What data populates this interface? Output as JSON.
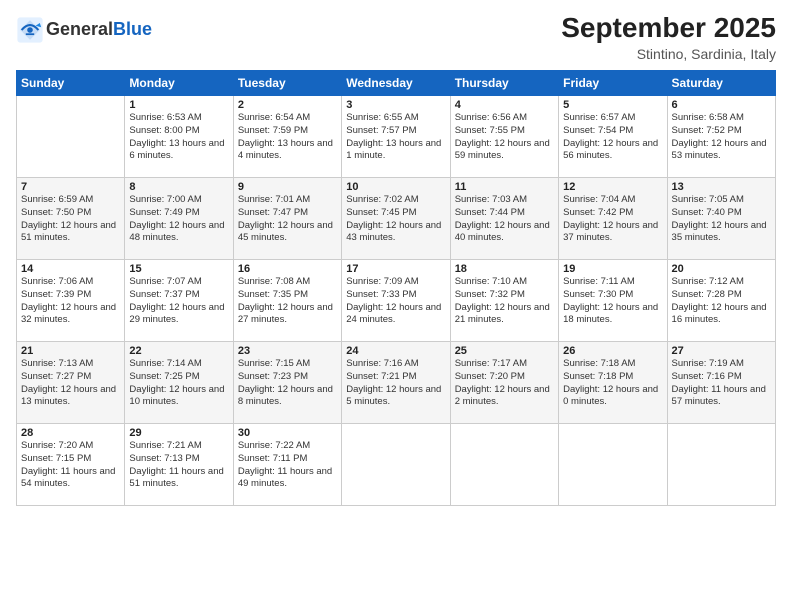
{
  "header": {
    "logo_text_general": "General",
    "logo_text_blue": "Blue",
    "title": "September 2025",
    "subtitle": "Stintino, Sardinia, Italy"
  },
  "days_of_week": [
    "Sunday",
    "Monday",
    "Tuesday",
    "Wednesday",
    "Thursday",
    "Friday",
    "Saturday"
  ],
  "weeks": [
    [
      {
        "date": "",
        "sunrise": "",
        "sunset": "",
        "daylight": ""
      },
      {
        "date": "1",
        "sunrise": "Sunrise: 6:53 AM",
        "sunset": "Sunset: 8:00 PM",
        "daylight": "Daylight: 13 hours and 6 minutes."
      },
      {
        "date": "2",
        "sunrise": "Sunrise: 6:54 AM",
        "sunset": "Sunset: 7:59 PM",
        "daylight": "Daylight: 13 hours and 4 minutes."
      },
      {
        "date": "3",
        "sunrise": "Sunrise: 6:55 AM",
        "sunset": "Sunset: 7:57 PM",
        "daylight": "Daylight: 13 hours and 1 minute."
      },
      {
        "date": "4",
        "sunrise": "Sunrise: 6:56 AM",
        "sunset": "Sunset: 7:55 PM",
        "daylight": "Daylight: 12 hours and 59 minutes."
      },
      {
        "date": "5",
        "sunrise": "Sunrise: 6:57 AM",
        "sunset": "Sunset: 7:54 PM",
        "daylight": "Daylight: 12 hours and 56 minutes."
      },
      {
        "date": "6",
        "sunrise": "Sunrise: 6:58 AM",
        "sunset": "Sunset: 7:52 PM",
        "daylight": "Daylight: 12 hours and 53 minutes."
      }
    ],
    [
      {
        "date": "7",
        "sunrise": "Sunrise: 6:59 AM",
        "sunset": "Sunset: 7:50 PM",
        "daylight": "Daylight: 12 hours and 51 minutes."
      },
      {
        "date": "8",
        "sunrise": "Sunrise: 7:00 AM",
        "sunset": "Sunset: 7:49 PM",
        "daylight": "Daylight: 12 hours and 48 minutes."
      },
      {
        "date": "9",
        "sunrise": "Sunrise: 7:01 AM",
        "sunset": "Sunset: 7:47 PM",
        "daylight": "Daylight: 12 hours and 45 minutes."
      },
      {
        "date": "10",
        "sunrise": "Sunrise: 7:02 AM",
        "sunset": "Sunset: 7:45 PM",
        "daylight": "Daylight: 12 hours and 43 minutes."
      },
      {
        "date": "11",
        "sunrise": "Sunrise: 7:03 AM",
        "sunset": "Sunset: 7:44 PM",
        "daylight": "Daylight: 12 hours and 40 minutes."
      },
      {
        "date": "12",
        "sunrise": "Sunrise: 7:04 AM",
        "sunset": "Sunset: 7:42 PM",
        "daylight": "Daylight: 12 hours and 37 minutes."
      },
      {
        "date": "13",
        "sunrise": "Sunrise: 7:05 AM",
        "sunset": "Sunset: 7:40 PM",
        "daylight": "Daylight: 12 hours and 35 minutes."
      }
    ],
    [
      {
        "date": "14",
        "sunrise": "Sunrise: 7:06 AM",
        "sunset": "Sunset: 7:39 PM",
        "daylight": "Daylight: 12 hours and 32 minutes."
      },
      {
        "date": "15",
        "sunrise": "Sunrise: 7:07 AM",
        "sunset": "Sunset: 7:37 PM",
        "daylight": "Daylight: 12 hours and 29 minutes."
      },
      {
        "date": "16",
        "sunrise": "Sunrise: 7:08 AM",
        "sunset": "Sunset: 7:35 PM",
        "daylight": "Daylight: 12 hours and 27 minutes."
      },
      {
        "date": "17",
        "sunrise": "Sunrise: 7:09 AM",
        "sunset": "Sunset: 7:33 PM",
        "daylight": "Daylight: 12 hours and 24 minutes."
      },
      {
        "date": "18",
        "sunrise": "Sunrise: 7:10 AM",
        "sunset": "Sunset: 7:32 PM",
        "daylight": "Daylight: 12 hours and 21 minutes."
      },
      {
        "date": "19",
        "sunrise": "Sunrise: 7:11 AM",
        "sunset": "Sunset: 7:30 PM",
        "daylight": "Daylight: 12 hours and 18 minutes."
      },
      {
        "date": "20",
        "sunrise": "Sunrise: 7:12 AM",
        "sunset": "Sunset: 7:28 PM",
        "daylight": "Daylight: 12 hours and 16 minutes."
      }
    ],
    [
      {
        "date": "21",
        "sunrise": "Sunrise: 7:13 AM",
        "sunset": "Sunset: 7:27 PM",
        "daylight": "Daylight: 12 hours and 13 minutes."
      },
      {
        "date": "22",
        "sunrise": "Sunrise: 7:14 AM",
        "sunset": "Sunset: 7:25 PM",
        "daylight": "Daylight: 12 hours and 10 minutes."
      },
      {
        "date": "23",
        "sunrise": "Sunrise: 7:15 AM",
        "sunset": "Sunset: 7:23 PM",
        "daylight": "Daylight: 12 hours and 8 minutes."
      },
      {
        "date": "24",
        "sunrise": "Sunrise: 7:16 AM",
        "sunset": "Sunset: 7:21 PM",
        "daylight": "Daylight: 12 hours and 5 minutes."
      },
      {
        "date": "25",
        "sunrise": "Sunrise: 7:17 AM",
        "sunset": "Sunset: 7:20 PM",
        "daylight": "Daylight: 12 hours and 2 minutes."
      },
      {
        "date": "26",
        "sunrise": "Sunrise: 7:18 AM",
        "sunset": "Sunset: 7:18 PM",
        "daylight": "Daylight: 12 hours and 0 minutes."
      },
      {
        "date": "27",
        "sunrise": "Sunrise: 7:19 AM",
        "sunset": "Sunset: 7:16 PM",
        "daylight": "Daylight: 11 hours and 57 minutes."
      }
    ],
    [
      {
        "date": "28",
        "sunrise": "Sunrise: 7:20 AM",
        "sunset": "Sunset: 7:15 PM",
        "daylight": "Daylight: 11 hours and 54 minutes."
      },
      {
        "date": "29",
        "sunrise": "Sunrise: 7:21 AM",
        "sunset": "Sunset: 7:13 PM",
        "daylight": "Daylight: 11 hours and 51 minutes."
      },
      {
        "date": "30",
        "sunrise": "Sunrise: 7:22 AM",
        "sunset": "Sunset: 7:11 PM",
        "daylight": "Daylight: 11 hours and 49 minutes."
      },
      {
        "date": "",
        "sunrise": "",
        "sunset": "",
        "daylight": ""
      },
      {
        "date": "",
        "sunrise": "",
        "sunset": "",
        "daylight": ""
      },
      {
        "date": "",
        "sunrise": "",
        "sunset": "",
        "daylight": ""
      },
      {
        "date": "",
        "sunrise": "",
        "sunset": "",
        "daylight": ""
      }
    ]
  ]
}
